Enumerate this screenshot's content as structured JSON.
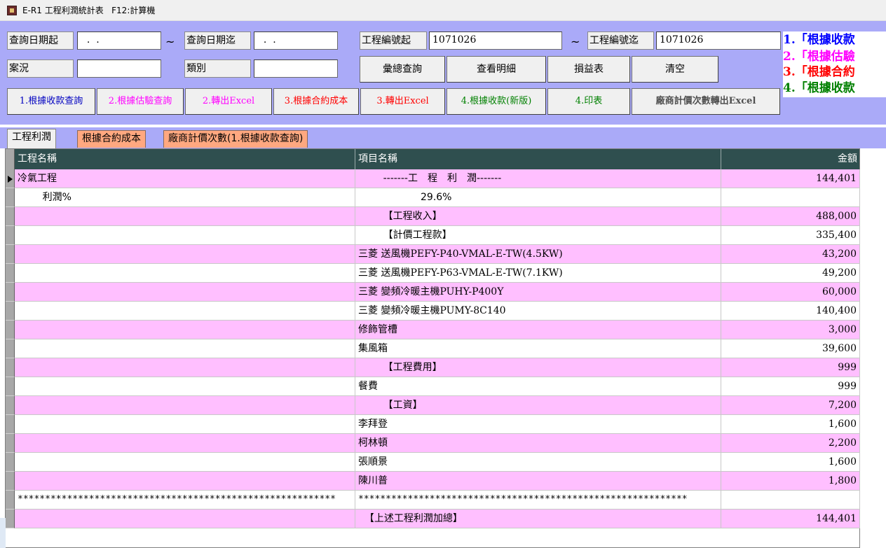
{
  "window": {
    "title": "E-R1 工程利潤統計表   F12:計算機"
  },
  "query": {
    "date_from_label": "查詢日期起",
    "date_from_value": "  .  .",
    "tilde": "~",
    "date_to_label": "查詢日期迄",
    "date_to_value": "  .  .",
    "proj_from_label": "工程編號起",
    "proj_from_value": "1071026",
    "proj_to_label": "工程編號迄",
    "proj_to_value": "1071026",
    "status_label": "案況",
    "status_value": "",
    "category_label": "類別",
    "category_value": ""
  },
  "buttons": {
    "summary": "彙總查詢",
    "detail": "查看明細",
    "pnl": "損益表",
    "clear": "清空",
    "b1": "1.根據收款查詢",
    "b2": "2.根據估驗查詢",
    "b3": "2.轉出Excel",
    "b4": "3.根據合約成本",
    "b5": "3.轉出Excel",
    "b6": "4.根據收款(新版)",
    "b7": "4.印表",
    "b8": "廠商計價次數轉出Excel"
  },
  "notes": [
    {
      "text": "1.「根據收款",
      "color": "#0000ff"
    },
    {
      "text": "2.「根據估驗",
      "color": "#ff00ff"
    },
    {
      "text": "3.「根據合約",
      "color": "#ff0000"
    },
    {
      "text": "4.「根據收款",
      "color": "#008000"
    }
  ],
  "tabs": [
    {
      "label": "工程利潤",
      "active": true
    },
    {
      "label": "根據合約成本",
      "active": false
    },
    {
      "label": "廠商計價次數(1.根據收款查詢)",
      "active": false
    }
  ],
  "grid": {
    "columns": [
      "工程名稱",
      "項目名稱",
      "金額"
    ],
    "rows": [
      {
        "c1": "冷氣工程",
        "c2": "        -------工　程　利　潤-------",
        "c3": "144,401",
        "pink": true,
        "current": true
      },
      {
        "c1": "        利潤%",
        "c2": "                    29.6%",
        "c3": "",
        "pink": false
      },
      {
        "c1": "",
        "c2": "        【工程收入】",
        "c3": "488,000",
        "pink": true
      },
      {
        "c1": "",
        "c2": "        【計價工程款】",
        "c3": "335,400",
        "pink": false
      },
      {
        "c1": "",
        "c2": "三菱 送風機PEFY-P40-VMAL-E-TW(4.5KW)",
        "c3": "43,200",
        "pink": true
      },
      {
        "c1": "",
        "c2": "三菱 送風機PEFY-P63-VMAL-E-TW(7.1KW)",
        "c3": "49,200",
        "pink": false
      },
      {
        "c1": "",
        "c2": "三菱 變頻冷暖主機PUHY-P400Y",
        "c3": "60,000",
        "pink": true
      },
      {
        "c1": "",
        "c2": "三菱 變頻冷暖主機PUMY-8C140",
        "c3": "140,400",
        "pink": false
      },
      {
        "c1": "",
        "c2": "修飾管槽",
        "c3": "3,000",
        "pink": true
      },
      {
        "c1": "",
        "c2": "集風箱",
        "c3": "39,600",
        "pink": false
      },
      {
        "c1": "",
        "c2": "        【工程費用】",
        "c3": "999",
        "pink": true
      },
      {
        "c1": "",
        "c2": "餐費",
        "c3": "999",
        "pink": false
      },
      {
        "c1": "",
        "c2": "        【工資】",
        "c3": "7,200",
        "pink": true
      },
      {
        "c1": "",
        "c2": "李拜登",
        "c3": "1,600",
        "pink": false
      },
      {
        "c1": "",
        "c2": "柯林頓",
        "c3": "2,200",
        "pink": true
      },
      {
        "c1": "",
        "c2": "張順景",
        "c3": "1,600",
        "pink": false
      },
      {
        "c1": "",
        "c2": "陳川普",
        "c3": "1,800",
        "pink": true
      },
      {
        "c1": "**********************************************************",
        "c2": "************************************************************",
        "c3": "",
        "pink": false,
        "stars": true
      },
      {
        "c1": "",
        "c2": "  【上述工程利潤加總】",
        "c3": "144,401",
        "pink": true
      }
    ]
  }
}
